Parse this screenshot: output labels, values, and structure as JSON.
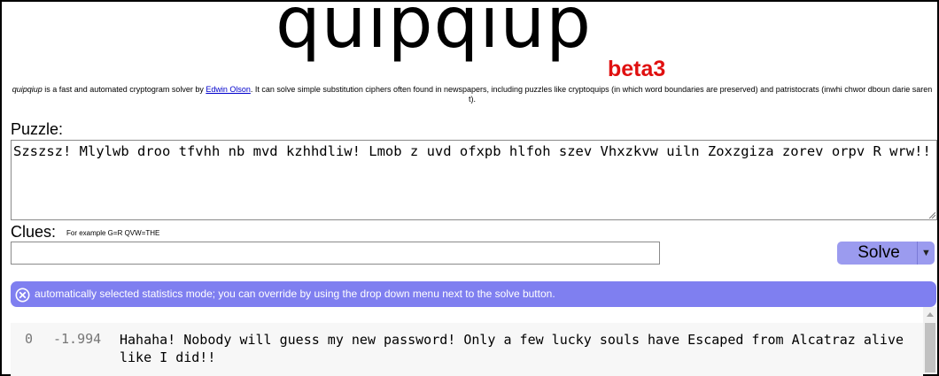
{
  "header": {
    "logo": "quipqiup",
    "version": "beta3"
  },
  "description": {
    "brand": "quipqiup",
    "part1": " is a fast and automated cryptogram solver by ",
    "author_link": "Edwin Olson",
    "part2": ". It can solve simple substitution ciphers often found in newspapers, including puzzles like cryptoquips (in which word boundaries are preserved) and patristocrats (inwhi chwor dboun darie saren t)."
  },
  "puzzle": {
    "label": "Puzzle:",
    "value": "Szszsz! Mlylwb droo tfvhh nb mvd kzhhdliw! Lmob z uvd ofxpb hlfoh szev Vhxzkvw uiln Zoxzgiza zorev orpv R wrw!!"
  },
  "clues": {
    "label": "Clues:",
    "hint": "For example G=R QVW=THE",
    "value": ""
  },
  "solve": {
    "label": "Solve",
    "dropdown_icon": "triangle-down-icon"
  },
  "notice": {
    "icon": "circle-x-icon",
    "text": "automatically selected statistics mode; you can override by using the drop down menu next to the solve button."
  },
  "results": [
    {
      "index": "0",
      "score": "-1.994",
      "text": "Hahaha! Nobody will guess my new password! Only a few lucky souls have Escaped from Alcatraz alive like I did!!"
    }
  ],
  "colors": {
    "beta": "#e01010",
    "button": "#9b9bef",
    "notice": "#7f7ff0"
  }
}
